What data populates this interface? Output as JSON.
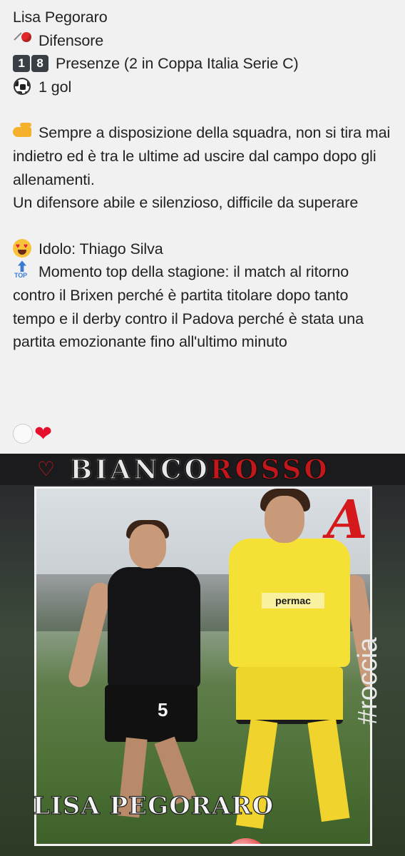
{
  "post": {
    "player_name": "Lisa Pegoraro",
    "role": "Difensore",
    "appearances_digits": [
      "1",
      "8"
    ],
    "appearances_text": "Presenze (2 in Coppa Italia Serie C)",
    "goals": "1 gol",
    "description_1": "Sempre a disposizione della squadra, non si tira mai indietro ed è tra le ultime ad uscire dal campo dopo gli allenamenti.",
    "description_2": "Un difensore abile e silenzioso, difficile da superare",
    "idol": "Idolo: Thiago Silva",
    "top_moment": "Momento top della stagione: il match al ritorno contro il Brixen perché è partita titolare dopo tanto tempo e il derby contro il Padova perché è stata una partita emozionante fino all'ultimo minuto",
    "top_badge_text": "TOP",
    "heart_glyph": "❤"
  },
  "image": {
    "banner_title_white": "BIANCO",
    "banner_title_red": "ROSSO",
    "banner_heart": "♡",
    "player_number": "5",
    "sponsor_logo": "permac",
    "logo_letter": "A",
    "name_plate": "LISA PEGORARO",
    "hashtag": "#roccia"
  },
  "icons": [
    "round-pushpin-icon",
    "keycap-1-icon",
    "keycap-8-icon",
    "soccer-ball-icon",
    "pointing-hand-icon",
    "heart-eyes-icon",
    "top-arrow-icon",
    "white-heart-icon",
    "red-heart-icon"
  ],
  "colors": {
    "text": "#222222",
    "background": "#f1f1f1",
    "accent_red": "#d4181c",
    "jersey_yellow": "#f5e035"
  }
}
